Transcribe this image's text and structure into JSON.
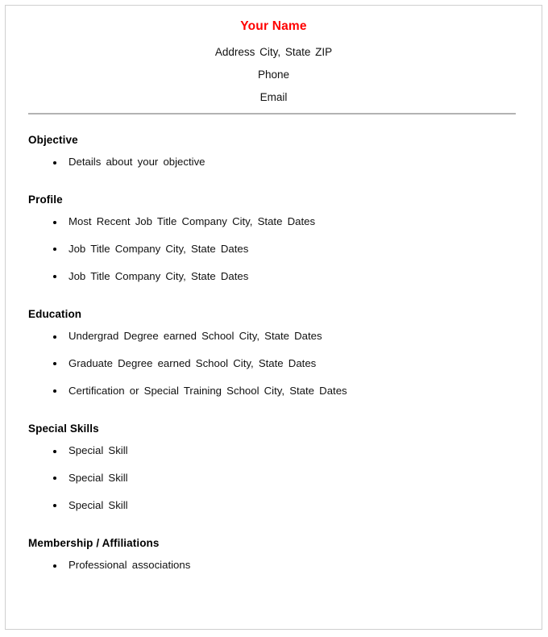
{
  "document": {
    "type": "resume-template",
    "accent_color": "#ff0000",
    "divider_color": "#b3b3b3",
    "page_border_color": "#cfcfcf"
  },
  "header": {
    "name": "Your Name",
    "address_line": "Address  City, State  ZIP",
    "phone_line": "Phone",
    "email_line": "Email"
  },
  "sections": [
    {
      "title": "Objective",
      "items": [
        "Details about your objective"
      ]
    },
    {
      "title": "Profile",
      "items": [
        "Most Recent Job Title   Company   City, State   Dates",
        "Job Title   Company   City, State   Dates",
        "Job Title   Company   City, State   Dates"
      ]
    },
    {
      "title": "Education",
      "items": [
        "Undergrad Degree earned  School  City, State  Dates",
        "Graduate Degree earned  School  City, State  Dates",
        "Certification or Special Training  School  City, State  Dates"
      ]
    },
    {
      "title": "Special Skills",
      "items": [
        "Special Skill",
        "Special Skill",
        "Special Skill"
      ]
    },
    {
      "title": "Membership / Affiliations",
      "items": [
        "Professional associations"
      ]
    }
  ]
}
